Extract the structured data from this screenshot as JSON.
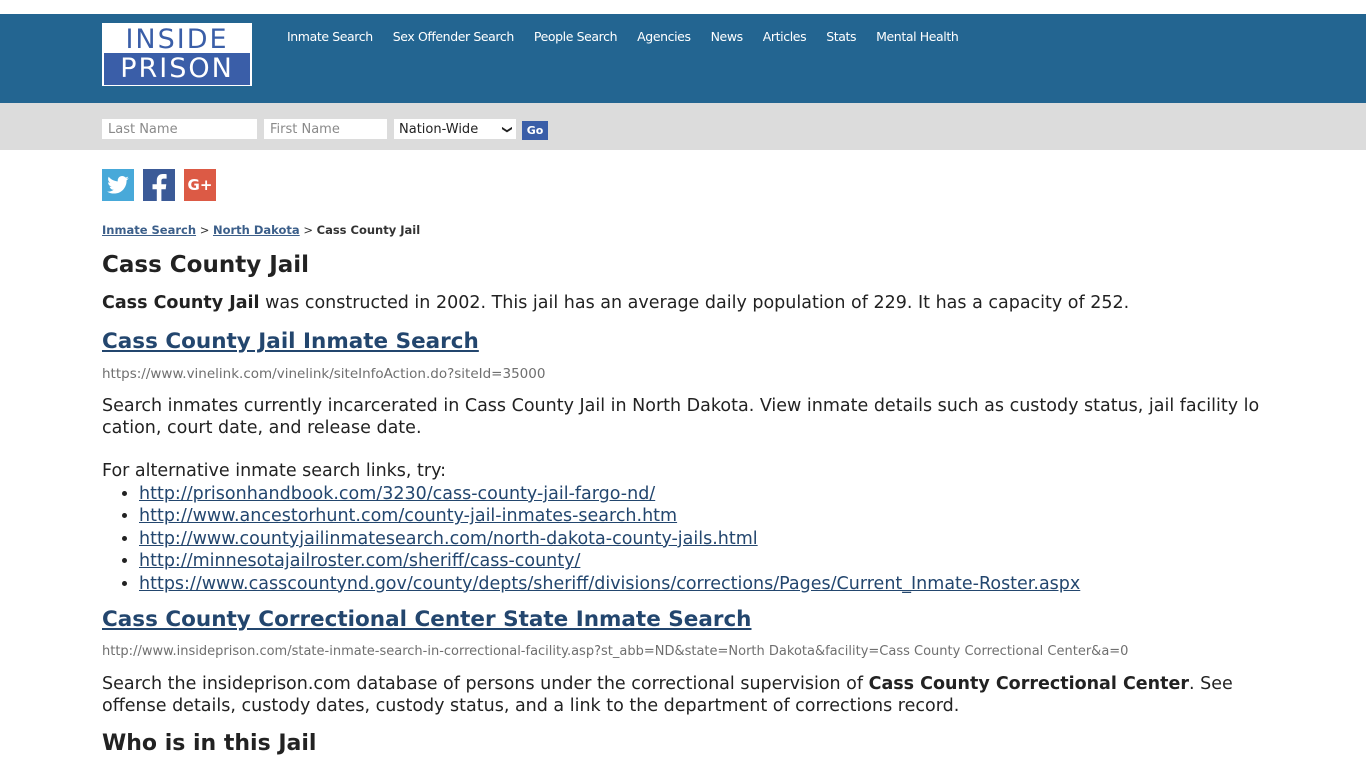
{
  "logo": {
    "line1": "INSIDE",
    "line2": "PRISON"
  },
  "nav": {
    "items": [
      {
        "label": "Inmate Search"
      },
      {
        "label": "Sex Offender Search"
      },
      {
        "label": "People Search"
      },
      {
        "label": "Agencies"
      },
      {
        "label": "News"
      },
      {
        "label": "Articles"
      },
      {
        "label": "Stats"
      },
      {
        "label": "Mental Health"
      }
    ]
  },
  "search": {
    "last_name_placeholder": "Last Name",
    "first_name_placeholder": "First Name",
    "last_name_value": "",
    "first_name_value": "",
    "scope_selected": "Nation-Wide",
    "go_label": "Go"
  },
  "social": {
    "twitter_glyph": "t",
    "facebook_glyph": "f",
    "googleplus_glyph": "G+"
  },
  "breadcrumb": {
    "items": [
      {
        "label": "Inmate Search"
      },
      {
        "label": "North Dakota"
      }
    ],
    "separator": ">",
    "current": "Cass County Jail"
  },
  "page": {
    "title": "Cass County Jail",
    "intro_bold": "Cass County Jail",
    "intro_rest": " was constructed in 2002. This jail has an average daily population of 229. It has a capacity of 252."
  },
  "section1": {
    "heading": "Cass County Jail Inmate Search",
    "url": "https://www.vinelink.com/vinelink/siteInfoAction.do?siteId=35000",
    "description": "Search inmates currently incarcerated in Cass County Jail in North Dakota. View inmate details such as custody status, jail facility location, court date, and release date.",
    "alt_intro": "For alternative inmate search links, try:",
    "alt_links": [
      "http://prisonhandbook.com/3230/cass-county-jail-fargo-nd/",
      "http://www.ancestorhunt.com/county-jail-inmates-search.htm",
      "http://www.countyjailinmatesearch.com/north-dakota-county-jails.html",
      "http://minnesotajailroster.com/sheriff/cass-county/",
      "https://www.casscountynd.gov/county/depts/sheriff/divisions/corrections/Pages/Current_Inmate-Roster.aspx"
    ]
  },
  "section2": {
    "heading": "Cass County Correctional Center State Inmate Search",
    "url": "http://www.insideprison.com/state-inmate-search-in-correctional-facility.asp?st_abb=ND&state=North Dakota&facility=Cass County Correctional Center&a=0",
    "description_pre": "Search the insideprison.com database of persons under the correctional supervision of ",
    "description_bold": "Cass County Correctional Center",
    "description_post": ". See offense details, custody dates, custody status, and a link to the department of corrections record."
  },
  "who": {
    "heading": "Who is in this Jail"
  },
  "colors": {
    "header_bg": "#236591",
    "search_bar_bg": "#dcdcdc",
    "brand_blue": "#3a5ea8",
    "link": "#23466e",
    "twitter": "#48a9d9",
    "facebook": "#3b5a97",
    "googleplus": "#dc5a45"
  }
}
